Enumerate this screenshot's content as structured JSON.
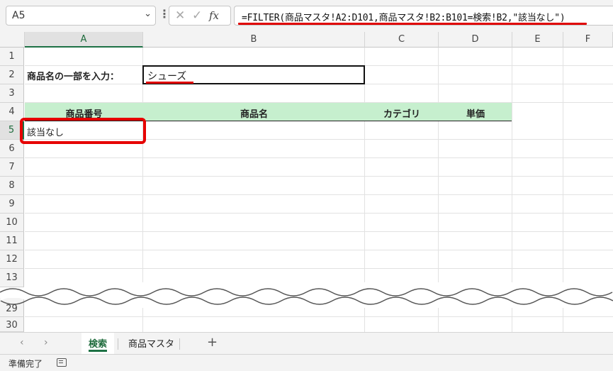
{
  "formula_bar": {
    "name_box": "A5",
    "name_box_caret": "⌄",
    "more_icon": "⋮",
    "cancel_glyph": "✕",
    "enter_glyph": "✓",
    "fx_glyph": "fx",
    "formula": "=FILTER(商品マスタ!A2:D101,商品マスタ!B2:B101=検索!B2,\"該当なし\")"
  },
  "columns": [
    "A",
    "B",
    "C",
    "D",
    "E",
    "F"
  ],
  "rows_top": [
    "1",
    "2",
    "3",
    "4",
    "5",
    "6",
    "7",
    "8",
    "9",
    "10",
    "11",
    "12",
    "13"
  ],
  "rows_bottom": [
    "29",
    "30"
  ],
  "sheet": {
    "prompt_label": "商品名の一部を入力：",
    "search_value": "シューズ",
    "headers": [
      "商品番号",
      "商品名",
      "カテゴリ",
      "単価"
    ],
    "result_a5": "該当なし"
  },
  "tabs": {
    "prev": "‹",
    "next": "›",
    "items": [
      "検索",
      "商品マスタ"
    ],
    "add": "+"
  },
  "status": {
    "text": "準備完了"
  },
  "colors": {
    "accent": "#1e7145",
    "header_fill": "#c6efce",
    "highlight": "#e60000"
  }
}
